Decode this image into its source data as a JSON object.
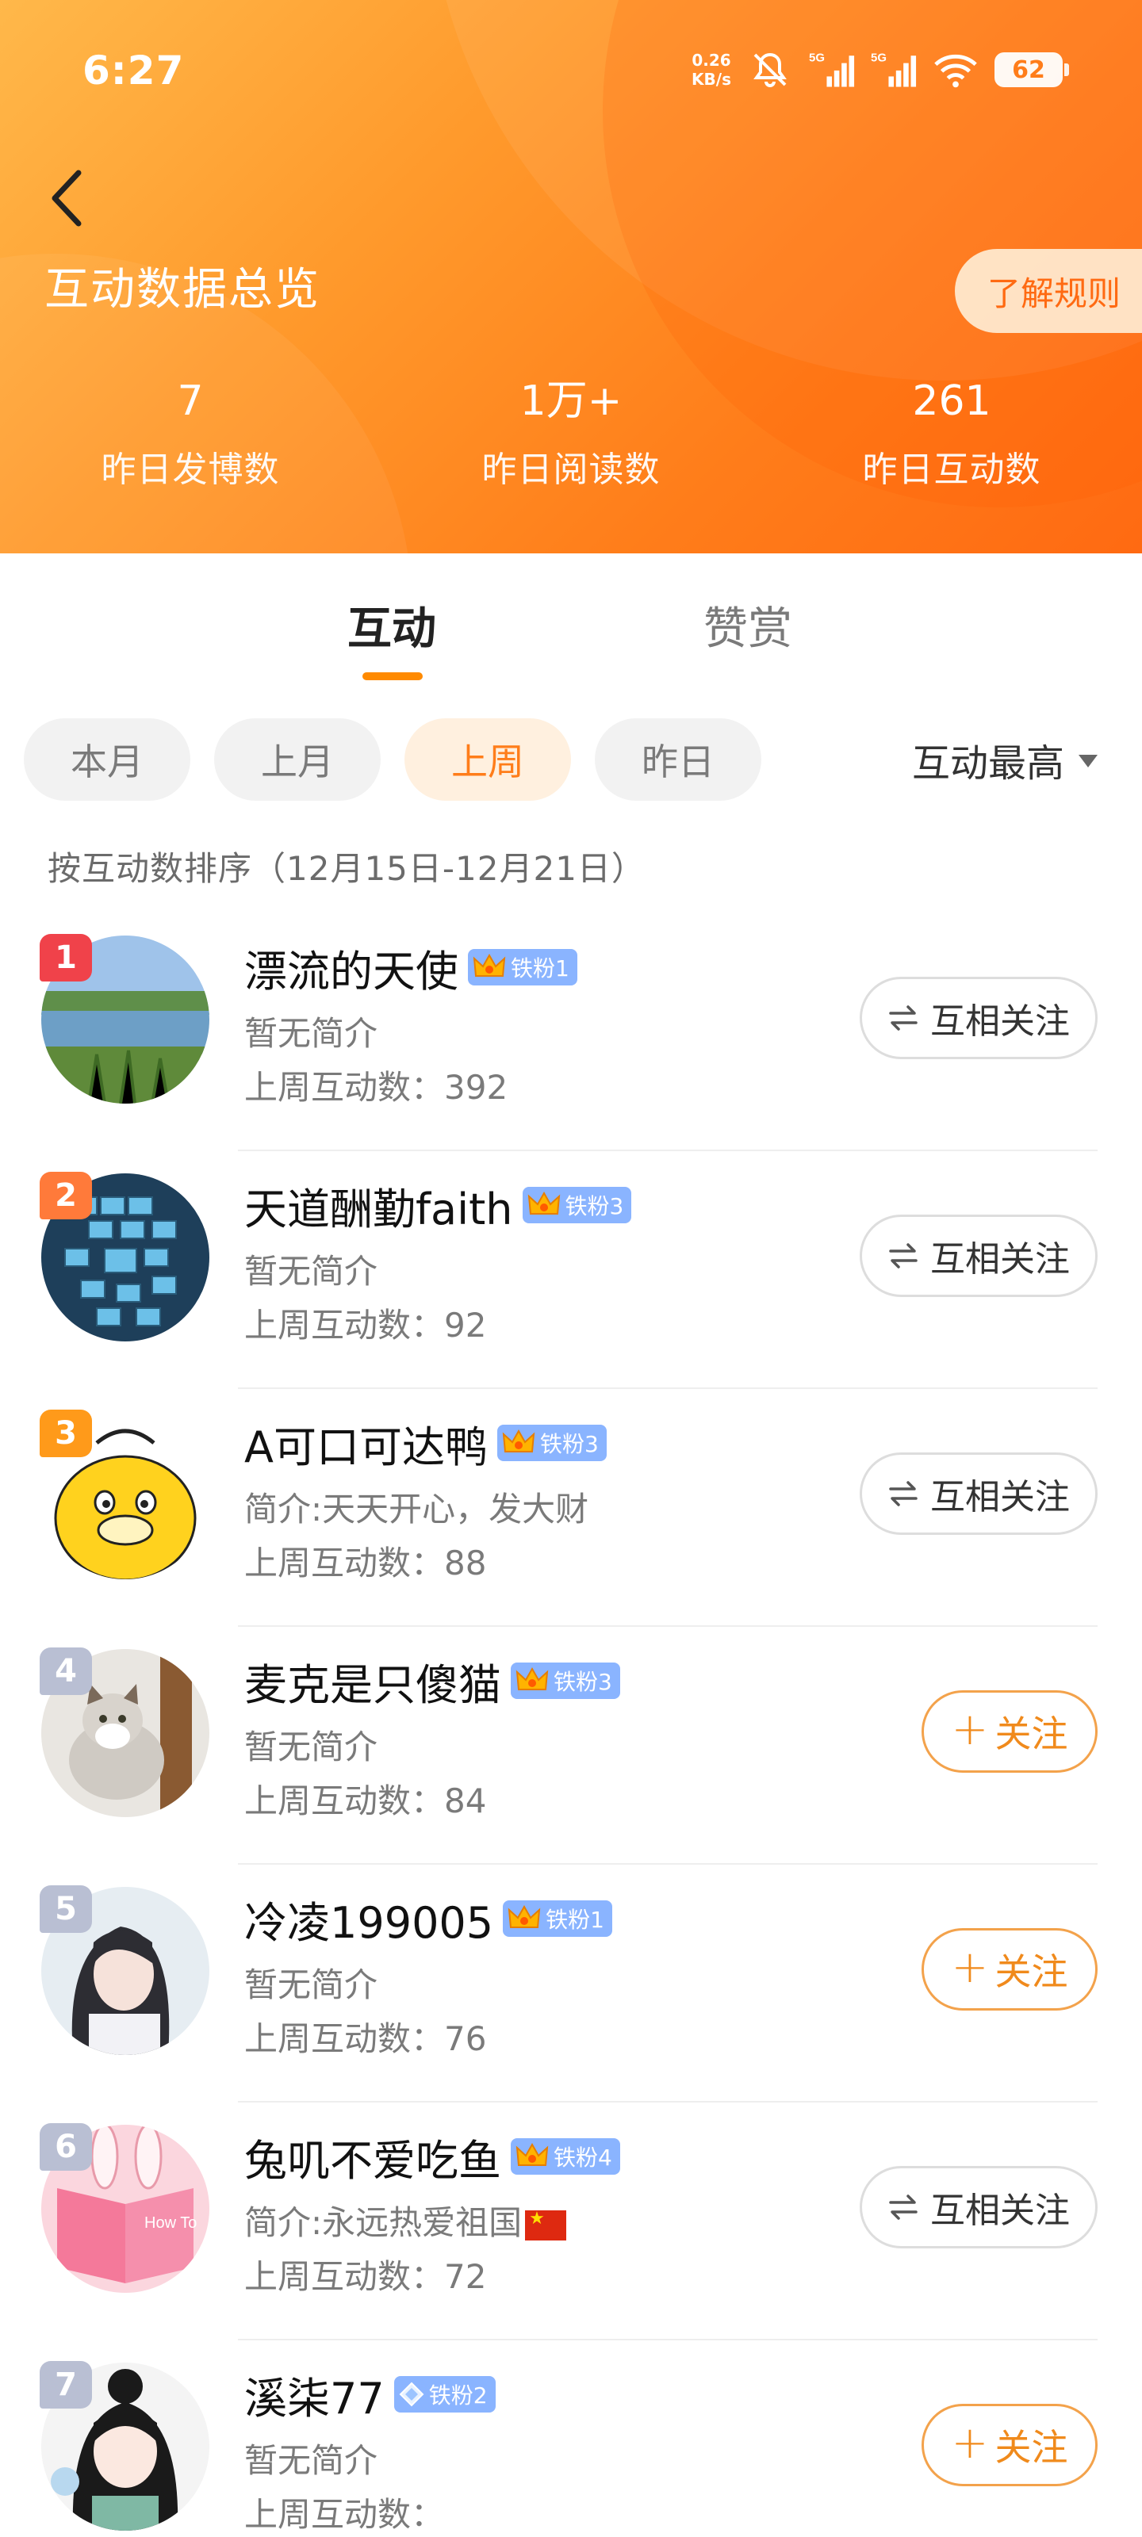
{
  "status_bar": {
    "time": "6:27",
    "net_speed_top": "0.26",
    "net_speed_bottom": "KB/s",
    "battery": "62"
  },
  "header": {
    "title": "互动数据总览",
    "rules_label": "了解规则",
    "stats": [
      {
        "value": "7",
        "label": "昨日发博数"
      },
      {
        "value": "1万+",
        "label": "昨日阅读数"
      },
      {
        "value": "261",
        "label": "昨日互动数"
      }
    ]
  },
  "tabs": [
    {
      "label": "互动"
    },
    {
      "label": "赞赏"
    }
  ],
  "filters": {
    "chips": [
      {
        "label": "本月"
      },
      {
        "label": "上月"
      },
      {
        "label": "上周"
      },
      {
        "label": "昨日"
      }
    ],
    "active_index": 2,
    "sort_label": "互动最高"
  },
  "sort_hint": "按互动数排序（12月15日-12月21日）",
  "list": [
    {
      "rank": "1",
      "name": "漂流的天使",
      "badge": "铁粉1",
      "badge_icon": "crown",
      "bio": "暂无简介",
      "count": "上周互动数：392",
      "button": "互相关注",
      "button_type": "mutual",
      "rank_color": "#f0424a"
    },
    {
      "rank": "2",
      "name": "天道酬勤faith",
      "badge": "铁粉3",
      "badge_icon": "crown",
      "bio": "暂无简介",
      "count": "上周互动数：92",
      "button": "互相关注",
      "button_type": "mutual",
      "rank_color": "#ff7a3a"
    },
    {
      "rank": "3",
      "name": "A可口可达鸭",
      "badge": "铁粉3",
      "badge_icon": "crown",
      "bio": "简介:天天开心，发大财",
      "count": "上周互动数：88",
      "button": "互相关注",
      "button_type": "mutual",
      "rank_color": "#ff9a1a"
    },
    {
      "rank": "4",
      "name": "麦克是只傻猫",
      "badge": "铁粉3",
      "badge_icon": "crown",
      "bio": "暂无简介",
      "count": "上周互动数：84",
      "button": "关注",
      "button_type": "follow",
      "rank_color": "#b9bfd3"
    },
    {
      "rank": "5",
      "name": "冷凌199005",
      "badge": "铁粉1",
      "badge_icon": "crown",
      "bio": "暂无简介",
      "count": "上周互动数：76",
      "button": "关注",
      "button_type": "follow",
      "rank_color": "#b9bfd3"
    },
    {
      "rank": "6",
      "name": "兔叽不爱吃鱼",
      "badge": "铁粉4",
      "badge_icon": "crown",
      "bio": "简介:永远热爱祖国",
      "count": "上周互动数：72",
      "button": "互相关注",
      "button_type": "mutual",
      "rank_color": "#b9bfd3"
    },
    {
      "rank": "7",
      "name": "溪柒77",
      "badge": "铁粉2",
      "badge_icon": "diamond",
      "bio": "暂无简介",
      "count": "上周互动数：",
      "button": "关注",
      "button_type": "follow",
      "rank_color": "#b9bfd3"
    }
  ]
}
